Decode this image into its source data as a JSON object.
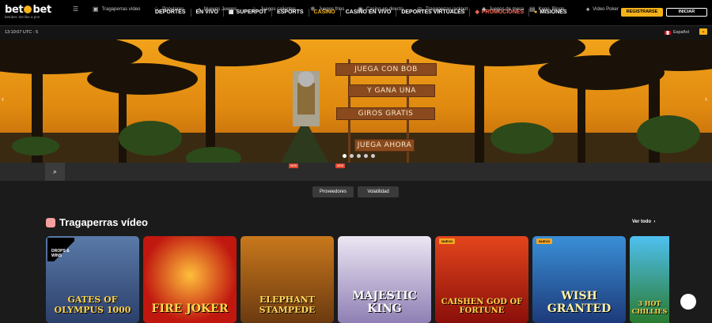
{
  "brand": {
    "name_left": "bet",
    "name_right": "bet",
    "tagline": "betobet. bet like a pro!"
  },
  "nav": {
    "items": [
      {
        "label": "DEPORTES"
      },
      {
        "label": "EN VIVO"
      },
      {
        "label": "SUPERPOT"
      },
      {
        "label": "ESPORTS"
      },
      {
        "label": "CASINO"
      },
      {
        "label": "CASINO EN VIVO"
      },
      {
        "label": "DEPORTES VIRTUALES"
      },
      {
        "label": "PROMOCIONES"
      },
      {
        "label": "MISIONES"
      }
    ]
  },
  "auth": {
    "register_label": "REGISTRARSE",
    "login_label": "INICIAR"
  },
  "subbar": {
    "time": "13:10:07 UTC - 5",
    "language": "Español"
  },
  "banner": {
    "signs": [
      "JUEGA CON BOB",
      "Y GANA UNA",
      "GIROS GRATIS",
      "JUEGA AHORA"
    ],
    "slides": 5,
    "active_slide": 0
  },
  "categories": [
    {
      "label": "Tragaperras vídeo",
      "icon": "slot-icon"
    },
    {
      "label": "Populares",
      "icon": "star-icon"
    },
    {
      "label": "Nuevos Juegos",
      "icon": "new-icon"
    },
    {
      "label": "Juegos calientes",
      "icon": "flame-icon",
      "badge": "NEW"
    },
    {
      "label": "Juegos fríos",
      "icon": "snowflake-icon",
      "badge": "NEW"
    },
    {
      "label": "Casino en directo",
      "icon": "live-icon"
    },
    {
      "label": "Tragaperras jackpot",
      "icon": "jackpot-icon"
    },
    {
      "label": "Juegos de mesa",
      "icon": "table-games-icon"
    },
    {
      "label": "Keno, Bingo",
      "icon": "bingo-icon"
    },
    {
      "label": "Video Poker",
      "icon": "poker-icon"
    }
  ],
  "filters": {
    "providers": "Proveedores",
    "volatility": "Volatilidad"
  },
  "section": {
    "title": "Tragaperras vídeo",
    "see_all": "Ver todo"
  },
  "games": [
    {
      "name": "GATES OF OLYMPUS 1000",
      "badge": "",
      "promo": "DROPS & WINS"
    },
    {
      "name": "FIRE JOKER",
      "badge": ""
    },
    {
      "name": "ELEPHANT STAMPEDE",
      "badge": ""
    },
    {
      "name": "MAJESTIC KING",
      "badge": ""
    },
    {
      "name": "CAISHEN GOD OF FORTUNE",
      "badge": "NUEVO"
    },
    {
      "name": "WISH GRANTED",
      "badge": "NUEVO"
    },
    {
      "name": "3 HOT CHILLIES",
      "badge": ""
    }
  ]
}
